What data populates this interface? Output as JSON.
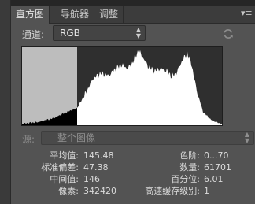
{
  "tabs": [
    {
      "label": "直方图",
      "active": true
    },
    {
      "label": "导航器",
      "active": false
    },
    {
      "label": "调整",
      "active": false
    }
  ],
  "panel_menu_icon": "panel-menu-icon",
  "channel": {
    "label": "通道:",
    "value": "RGB"
  },
  "refresh_icon": "refresh-icon",
  "histogram": {
    "selection_start": 0,
    "selection_end": 70,
    "colors": {
      "bars": "#ffffff",
      "selected_bars": "#000000",
      "selection_bg": "#bdbdbd",
      "bg": "#2f2f2f"
    }
  },
  "source": {
    "label": "源:",
    "value": "整个图像"
  },
  "stats": {
    "mean_label": "平均值:",
    "mean": "145.48",
    "stddev_label": "标准偏差:",
    "stddev": "47.38",
    "median_label": "中间值:",
    "median": "146",
    "pixels_label": "像素:",
    "pixels": "342420",
    "level_label": "色阶:",
    "level": "0...70",
    "count_label": "数量:",
    "count": "61701",
    "percentile_label": "百分位:",
    "percentile": "6.01",
    "cache_label": "高速缓存级别:",
    "cache": "1"
  }
}
